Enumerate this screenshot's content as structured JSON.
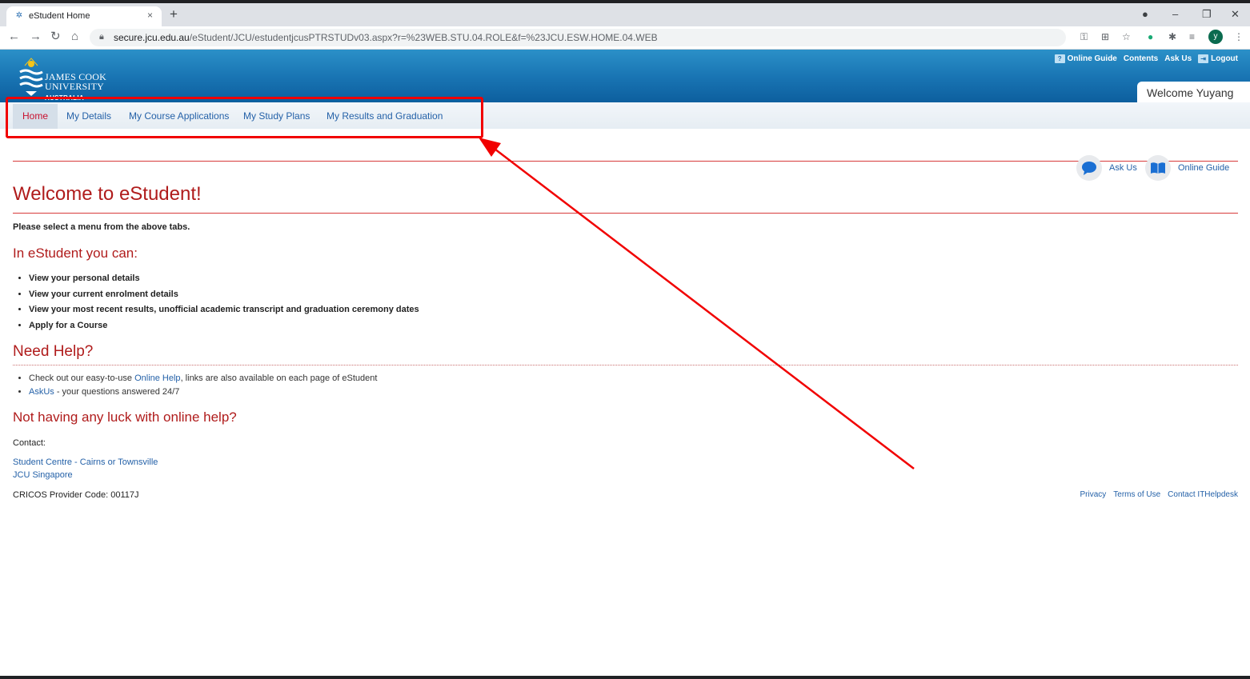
{
  "browser": {
    "tab_title": "eStudent Home",
    "tab_close": "×",
    "new_tab": "+",
    "url_host": "secure.jcu.edu.au",
    "url_path": "/eStudent/JCU/estudentjcusPTRSTUDv03.aspx?r=%23WEB.STU.04.ROLE&f=%23JCU.ESW.HOME.04.WEB",
    "profile_initial": "y"
  },
  "header": {
    "logo_line1": "JAMES COOK",
    "logo_line2": "UNIVERSITY",
    "logo_country": "AUSTRALIA",
    "util_links": [
      "Online Guide",
      "Contents",
      "Ask Us",
      "Logout"
    ],
    "welcome": "Welcome Yuyang"
  },
  "menu": {
    "tabs": [
      "Home",
      "My Details",
      "My Course Applications",
      "My Study Plans",
      "My Results and Graduation"
    ],
    "active": "Home"
  },
  "helpers": {
    "ask_us": "Ask Us",
    "online_guide": "Online Guide"
  },
  "content": {
    "title": "Welcome to eStudent!",
    "instruction": "Please select a menu from the above tabs.",
    "can_heading": "In eStudent you can:",
    "can_items": [
      "View your personal details",
      "View your current enrolment details",
      "View your most recent results, unofficial academic transcript and graduation ceremony dates",
      "Apply for a Course"
    ],
    "help_heading": "Need Help?",
    "help_item1_prefix": "Check out our easy-to-use ",
    "help_item1_link": "Online Help",
    "help_item1_suffix": ", links are also available on each page of eStudent",
    "help_item2_link": "AskUs",
    "help_item2_suffix": " - your questions answered 24/7",
    "luck_heading": "Not having any luck with online help?",
    "contact_label": "Contact:",
    "contact_link1": "Student Centre - Cairns or Townsville",
    "contact_link2": "JCU Singapore",
    "cricos": "CRICOS Provider Code: 00117J"
  },
  "footer": {
    "links": [
      "Privacy",
      "Terms of Use",
      "Contact ITHelpdesk"
    ]
  },
  "colors": {
    "header_blue": "#1873b2",
    "link_blue": "#2461a8",
    "heading_red": "#b01c1c",
    "annotation_red": "#f10000"
  }
}
